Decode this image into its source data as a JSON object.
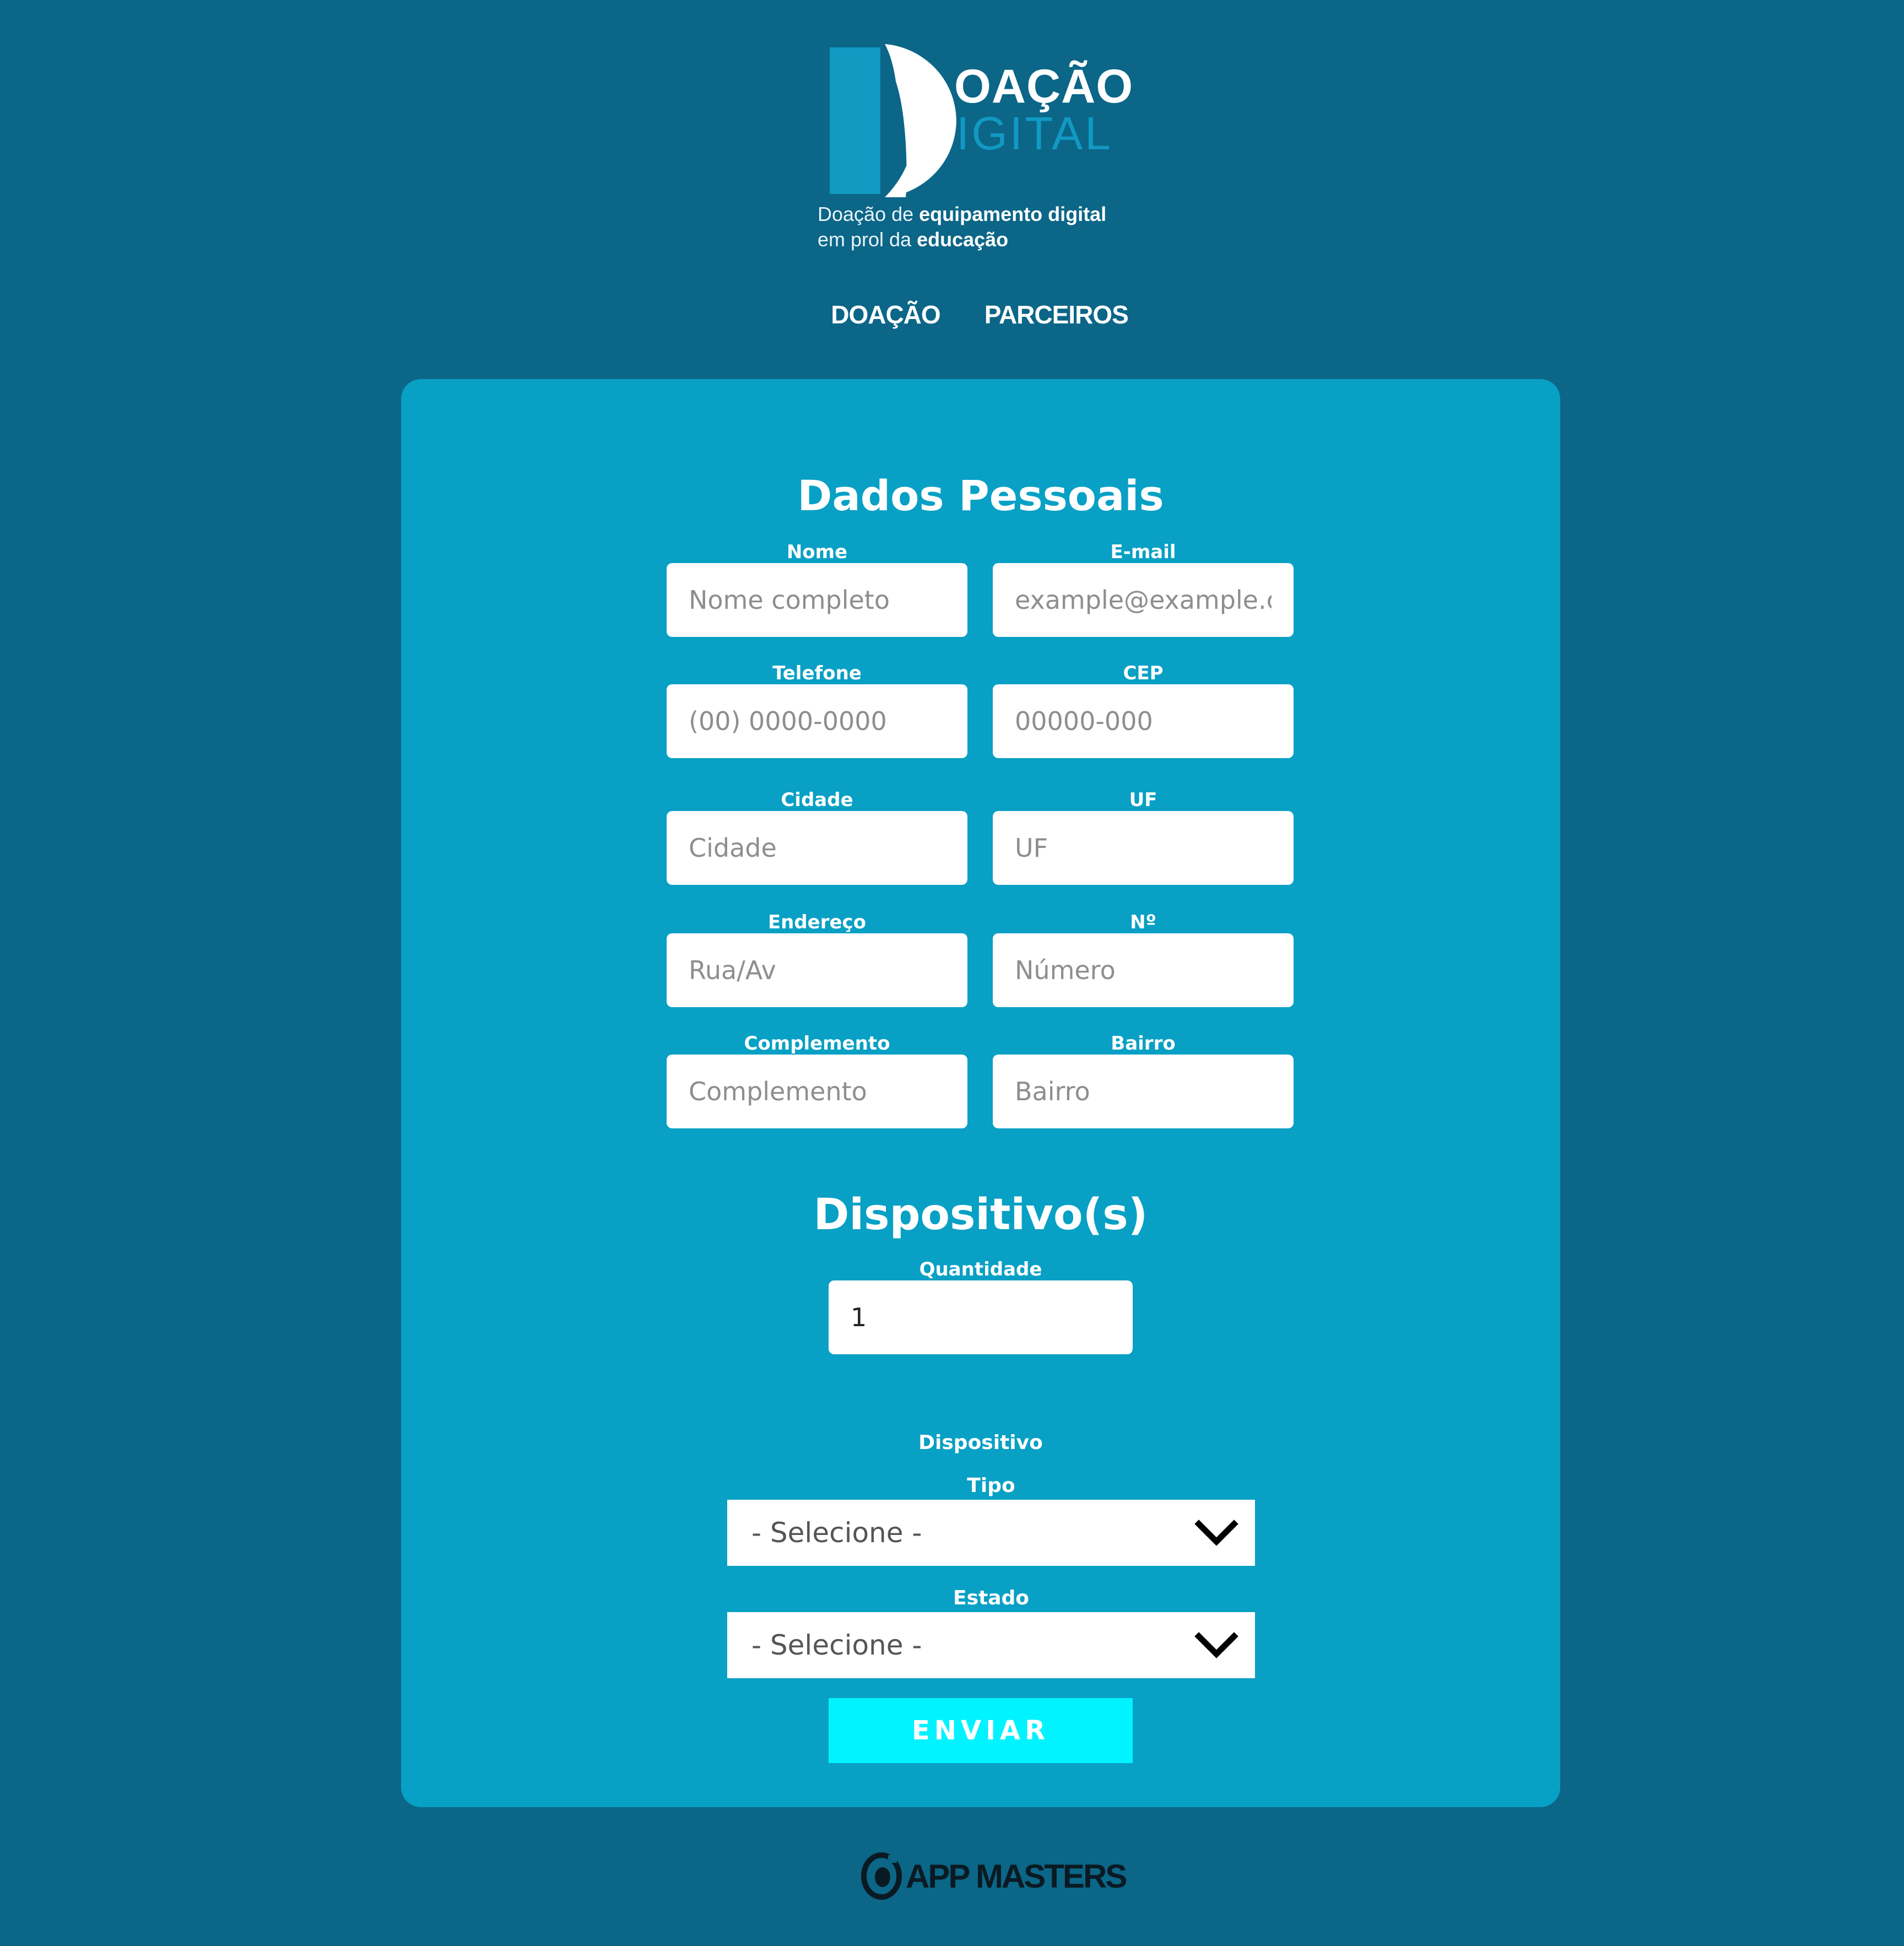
{
  "logo": {
    "word1": "OAÇÃO",
    "word2": "IGITAL",
    "tagline_part1": "Doação de ",
    "tagline_bold1": "equipamento digital",
    "tagline_part2": "em prol da ",
    "tagline_bold2": "educação"
  },
  "nav": {
    "items": [
      {
        "label": "DOAÇÃO"
      },
      {
        "label": "PARCEIROS"
      }
    ]
  },
  "personal": {
    "title": "Dados Pessoais",
    "fields": [
      {
        "label": "Nome",
        "placeholder": "Nome completo"
      },
      {
        "label": "E-mail",
        "placeholder": "example@example.com"
      },
      {
        "label": "Telefone",
        "placeholder": "(00) 0000-0000"
      },
      {
        "label": "CEP",
        "placeholder": "00000-000"
      },
      {
        "label": "Cidade",
        "placeholder": "Cidade"
      },
      {
        "label": "UF",
        "placeholder": "UF"
      },
      {
        "label": "Endereço",
        "placeholder": "Rua/Av"
      },
      {
        "label": "Nº",
        "placeholder": "Número"
      },
      {
        "label": "Complemento",
        "placeholder": "Complemento"
      },
      {
        "label": "Bairro",
        "placeholder": "Bairro"
      }
    ]
  },
  "devices": {
    "title": "Dispositivo(s)",
    "quantity_label": "Quantidade",
    "quantity_value": "1",
    "device_heading": "Dispositivo",
    "type_label": "Tipo",
    "type_selected": "- Selecione -",
    "state_label": "Estado",
    "state_selected": "- Selecione -",
    "submit_label": "ENVIAR"
  },
  "footer": {
    "brand": "APP MASTERS"
  },
  "colors": {
    "background": "#0b6688",
    "card": "#08a0c5",
    "button": "#00f3ff",
    "logo_accent": "#1199c2"
  }
}
